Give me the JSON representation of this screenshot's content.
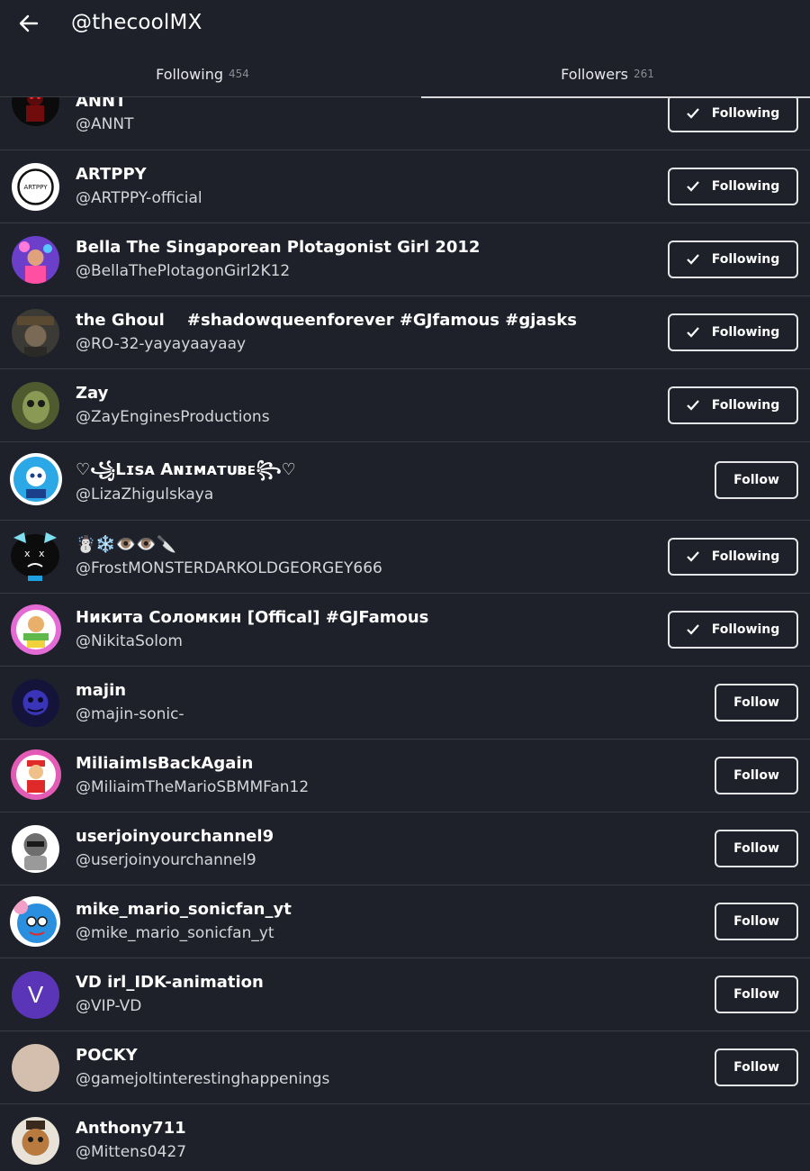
{
  "header": {
    "title": "@thecoolMX"
  },
  "tabs": [
    {
      "label": "Following",
      "count": "454"
    },
    {
      "label": "Followers",
      "count": "261"
    }
  ],
  "buttons": {
    "following_label": "Following",
    "follow_label": "Follow"
  },
  "users": [
    {
      "name": "ANNT",
      "handle": "@ANNT",
      "state": "Following"
    },
    {
      "name": "ARTPPY",
      "handle": "@ARTPPY-official",
      "state": "Following",
      "avatar_text": "ARTPPY"
    },
    {
      "name": "Bella The Singaporean Plotagonist Girl 2012",
      "handle": "@BellaThePlotagonGirl2K12",
      "state": "Following"
    },
    {
      "name": "the Ghoul    #shadowqueenforever #GJfamous #gjasks",
      "handle": "@RO-32-yayayaayaay",
      "state": "Following"
    },
    {
      "name": "Zay",
      "handle": "@ZayEnginesProductions",
      "state": "Following"
    },
    {
      "name": "♡꧁Lɪsᴀ Aɴɪᴍᴀᴛᴜʙᴇ꧂♡",
      "handle": "@LizaZhigulskaya",
      "state": "Follow"
    },
    {
      "name": "☃️❄️👁️👁️🔪",
      "handle": "@FrostMONSTERDARKOLDGEORGEY666",
      "state": "Following"
    },
    {
      "name": "Никита Соломкин [Offical] #GJFamous",
      "handle": "@NikitaSolom",
      "state": "Following"
    },
    {
      "name": "majin",
      "handle": "@majin-sonic-",
      "state": "Follow"
    },
    {
      "name": "MiliaimIsBackAgain",
      "handle": "@MiliaimTheMarioSBMMFan12",
      "state": "Follow"
    },
    {
      "name": "userjoinyourchannel9",
      "handle": "@userjoinyourchannel9",
      "state": "Follow"
    },
    {
      "name": "mike_mario_sonicfan_yt",
      "handle": "@mike_mario_sonicfan_yt",
      "state": "Follow"
    },
    {
      "name": "VD irl_IDK-animation",
      "handle": "@VIP-VD",
      "state": "Follow",
      "avatar_text": "V"
    },
    {
      "name": "POCKY",
      "handle": "@gamejoltinterestinghappenings",
      "state": "Follow"
    },
    {
      "name": "Anthony711",
      "handle": "@Mittens0427",
      "state": "none"
    }
  ],
  "colors": {
    "background": "#1f212a",
    "divider": "#3a3c45",
    "button_border": "#e5e5e7"
  }
}
